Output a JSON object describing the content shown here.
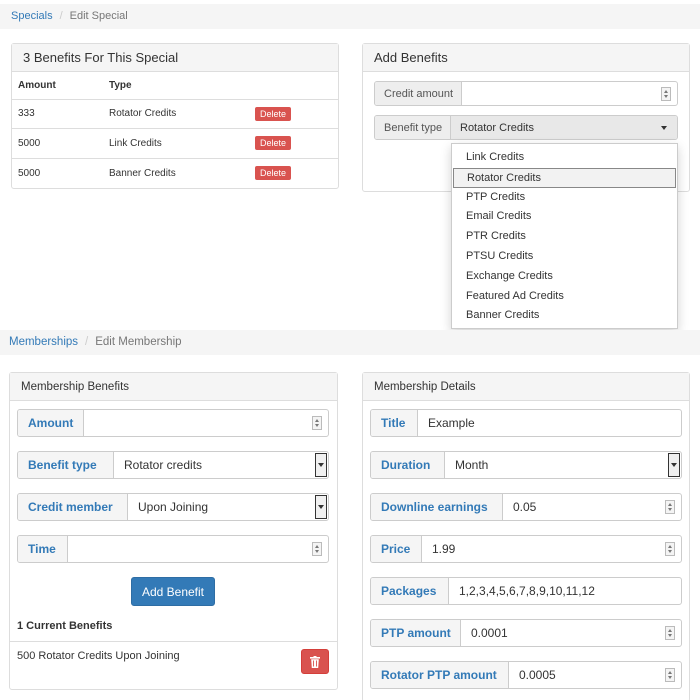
{
  "top_breadcrumb": {
    "parent": "Specials",
    "current": "Edit Special"
  },
  "benefits_panel": {
    "title": "3 Benefits For This Special",
    "columns": [
      "Amount",
      "Type"
    ],
    "rows": [
      {
        "amount": "333",
        "type": "Rotator Credits",
        "action": "Delete"
      },
      {
        "amount": "5000",
        "type": "Link Credits",
        "action": "Delete"
      },
      {
        "amount": "5000",
        "type": "Banner Credits",
        "action": "Delete"
      }
    ]
  },
  "add_benefits": {
    "title": "Add Benefits",
    "credit_amount_label": "Credit amount",
    "credit_amount_value": "",
    "benefit_type_label": "Benefit type",
    "benefit_type_value": "Rotator Credits",
    "options": [
      "Link Credits",
      "Rotator Credits",
      "PTP Credits",
      "Email Credits",
      "PTR Credits",
      "PTSU Credits",
      "Exchange Credits",
      "Featured Ad Credits",
      "Banner Credits"
    ],
    "selected_index": 1
  },
  "bottom_breadcrumb": {
    "parent": "Memberships",
    "current": "Edit Membership"
  },
  "membership_benefits": {
    "title": "Membership Benefits",
    "amount_label": "Amount",
    "amount_value": "",
    "benefit_type_label": "Benefit type",
    "benefit_type_value": "Rotator credits",
    "credit_member_label": "Credit member",
    "credit_member_value": "Upon Joining",
    "time_label": "Time",
    "time_value": "",
    "add_button": "Add Benefit",
    "current_heading": "1 Current Benefits",
    "current_items": [
      "500 Rotator Credits Upon Joining"
    ]
  },
  "membership_details": {
    "title": "Membership Details",
    "fields": {
      "title": {
        "label": "Title",
        "value": "Example"
      },
      "duration": {
        "label": "Duration",
        "value": "Month"
      },
      "downline": {
        "label": "Downline earnings",
        "value": "0.05"
      },
      "price": {
        "label": "Price",
        "value": "1.99"
      },
      "packages": {
        "label": "Packages",
        "value": "1,2,3,4,5,6,7,8,9,10,11,12"
      },
      "ptp_amount": {
        "label": "PTP amount",
        "value": "0.0001"
      },
      "rotator_ptp": {
        "label": "Rotator PTP amount",
        "value": "0.0005"
      }
    }
  },
  "colors": {
    "link": "#337ab7",
    "danger": "#d9534f",
    "primary": "#337ab7"
  },
  "icons": {
    "delete_current_benefit": "trash-icon"
  }
}
